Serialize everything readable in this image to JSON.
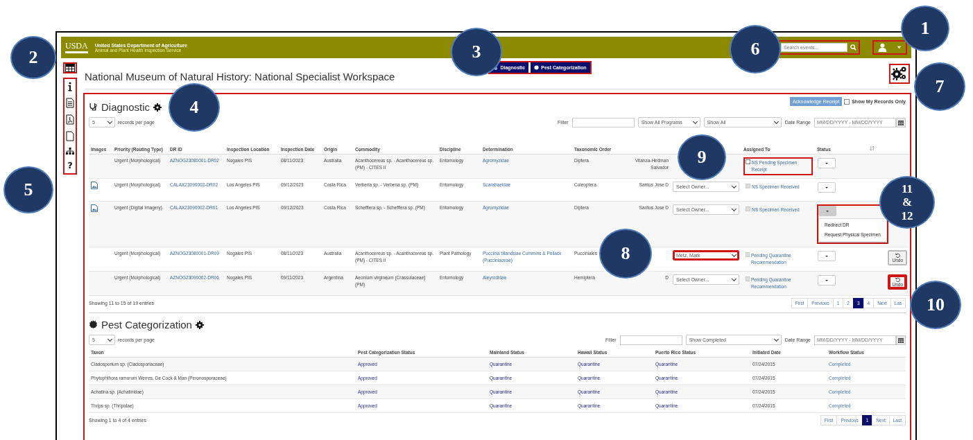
{
  "header": {
    "logo": "USDA",
    "agency": "United States Department of Agriculture",
    "subagency": "Animal and Plant Health Inspection Service",
    "search": {
      "placeholder": "Search events...",
      "highlighted": true
    },
    "user_menu_highlighted": true
  },
  "sidebar": {
    "top_highlighted": true,
    "tools_highlighted": true,
    "help_glyph": "?"
  },
  "page_title": "National Museum of Natural History: National Specialist Workspace",
  "tabs": {
    "highlighted": true,
    "items": [
      {
        "label": "Diagnostic",
        "kind": "diagnostic"
      },
      {
        "label": "Pest Categorization",
        "kind": "pest"
      }
    ]
  },
  "settings_highlighted": true,
  "diagnostic": {
    "title": "Diagnostic",
    "highlighted": true,
    "acknowledge_button": "Acknowledge Receipt",
    "show_my_records": {
      "label": "Show My Records Only",
      "checked": false
    },
    "page_size": "5",
    "page_size_label": "records per page",
    "filter_label": "Filter",
    "program_select": "Show All Programs",
    "status_select": "Show All",
    "date_label": "Date Range",
    "date_placeholder": "MM/DD/YYYY - MM/DD/YYYY",
    "columns": [
      "Images",
      "Priority (Routing Type)",
      "DR ID",
      "Inspection Location",
      "Inspection Date",
      "Origin",
      "Commodity",
      "Discipline",
      "Determination",
      "Taxonomic Order"
    ],
    "columns_right": [
      "Assigned To",
      "Status"
    ],
    "rows": [
      {
        "image": false,
        "priority": "Urgent (Morphological)",
        "dr_id": "AZNOG23080001-DR02",
        "location": "Nogales PIS",
        "date": "08/11/2023",
        "origin": "Australia",
        "commodity": "Acanthocereus sp. - Acanthocereus sp. (PM) - CITES II",
        "discipline": "Entomology",
        "determination": "Agromyzidae",
        "order": "Diptera",
        "identifier": "Vitanza-Hedman Salvador",
        "assigned": {
          "text": "NS Pending Specimen Receipt",
          "disabled": false,
          "highlighted": true
        },
        "status": {
          "label": "...",
          "open": false,
          "highlighted": false
        }
      },
      {
        "image": true,
        "priority": "Urgent (Morphological)",
        "dr_id": "CALAX23090002-DR02",
        "location": "Los Angeles PIS",
        "date": "09/12/2023",
        "origin": "Costa Rica",
        "commodity": "Verbena sp. - Verbena sp. (PM)",
        "discipline": "Entomology",
        "determination": "Scarabaeidae",
        "order": "Coleoptera",
        "identifier": "Santos Jose D",
        "owner": {
          "value": "Select Owner...",
          "highlighted": false
        },
        "assigned": {
          "text": "NS Specimen Received",
          "disabled": true,
          "highlighted": false
        },
        "status": {
          "label": "...",
          "open": false,
          "highlighted": false
        }
      },
      {
        "image": true,
        "priority": "Urgent (Digital Imagery)",
        "dr_id": "CALAX23090002-DR01",
        "location": "Los Angeles PIS",
        "date": "09/12/2023",
        "origin": "Costa Rica",
        "commodity": "Schefflera sp. - Schefflera sp. (PM)",
        "discipline": "Entomology",
        "determination": "Agromyzidae",
        "order": "Diptera",
        "identifier": "Santos Jose D",
        "owner": {
          "value": "Select Owner...",
          "highlighted": false
        },
        "assigned": {
          "text": "NS Specimen Received",
          "disabled": true,
          "highlighted": false
        },
        "status": {
          "label": "...",
          "open": true,
          "highlighted": true,
          "menu": [
            "Redirect DR",
            "Request Physical Specimen"
          ]
        }
      },
      {
        "image": false,
        "priority": "Urgent (Morphological)",
        "dr_id": "AZNOG23080001-DR09",
        "location": "Nogales PIS",
        "date": "08/11/2023",
        "origin": "Australia",
        "commodity": "Acanthocereus sp. - Acanthocereus sp. (PM) - CITES II",
        "discipline": "Plant Pathology",
        "determination": "Puccinia tillandsiae Cummins & Pollack (Pucciniaceae)",
        "order": "Pucciniales",
        "owner": {
          "value": "Metz, Mark",
          "highlighted": true
        },
        "assigned": {
          "text": "Pending Quarantine Recommendation",
          "disabled": true,
          "highlighted": false
        },
        "status": {
          "label": "...",
          "open": false,
          "highlighted": false
        },
        "undo": {
          "label": "Undo",
          "highlighted": false
        }
      },
      {
        "image": false,
        "priority": "Urgent (Morphological)",
        "dr_id": "AZNOG23090002-DR06",
        "location": "Nogales PIS",
        "date": "09/11/2023",
        "origin": "Argentina",
        "commodity": "Aeonium virgineum (Crassulaceae) (PM)",
        "discipline": "Entomology",
        "determination": "Aleyrodidae",
        "order": "Hemiptera",
        "identifier": "D",
        "owner": {
          "value": "Select Owner...",
          "highlighted": false
        },
        "assigned": {
          "text": "Pending Quarantine Recommendation",
          "disabled": true,
          "highlighted": false
        },
        "status": {
          "label": "...",
          "open": false,
          "highlighted": false
        },
        "undo": {
          "label": "Undo",
          "highlighted": true
        }
      }
    ],
    "summary": "Showing 11 to 15 of 19 entries",
    "pagination": [
      {
        "label": "First",
        "selected": false
      },
      {
        "label": "Previous",
        "selected": false
      },
      {
        "label": "1",
        "selected": false
      },
      {
        "label": "2",
        "selected": false
      },
      {
        "label": "3",
        "selected": true
      },
      {
        "label": "4",
        "selected": false
      },
      {
        "label": "Next",
        "selected": false
      },
      {
        "label": "Las",
        "selected": false
      }
    ]
  },
  "pest": {
    "title": "Pest Categorization",
    "page_size": "5",
    "page_size_label": "records per page",
    "filter_label": "Filter",
    "status_select": "Show Completed",
    "date_label": "Date Range",
    "date_placeholder": "MM/DD/YYYY - MM/DD/YYYY",
    "columns": [
      "Taxon",
      "Pest Categorization Status",
      "Mainland Status",
      "Hawaii Status",
      "Puerto Rico Status",
      "Initiated Date",
      "Workflow Status"
    ],
    "rows": [
      [
        "Cladosporium sp. (Cladosporiaceae)",
        "Approved",
        "Quarantine",
        "Quarantine",
        "Quarantine",
        "07/24/2015",
        "Completed"
      ],
      [
        "Phytophthora ramorum Werres, De Cock & Man (Peronosporaceae)",
        "Approved",
        "Quarantine",
        "Quarantine",
        "Quarantine",
        "07/24/2015",
        "Completed"
      ],
      [
        "Achatina sp. (Achatinidae)",
        "Approved",
        "Quarantine",
        "Quarantine",
        "Quarantine",
        "07/24/2015",
        "Completed"
      ],
      [
        "Thrips sp. (Thripidae)",
        "Approved",
        "Quarantine",
        "Quarantine",
        "Quarantine",
        "07/24/2015",
        "Completed"
      ]
    ],
    "summary": "Showing 1 to 4 of 4 entries",
    "pagination": [
      {
        "label": "First",
        "selected": false
      },
      {
        "label": "Previous",
        "selected": false
      },
      {
        "label": "1",
        "selected": true
      },
      {
        "label": "Next",
        "selected": false
      },
      {
        "label": "Last",
        "selected": false
      }
    ]
  },
  "callouts": [
    {
      "lines": [
        "1"
      ]
    },
    {
      "lines": [
        "2"
      ]
    },
    {
      "lines": [
        "3"
      ]
    },
    {
      "lines": [
        "4"
      ]
    },
    {
      "lines": [
        "5"
      ]
    },
    {
      "lines": [
        "6"
      ]
    },
    {
      "lines": [
        "7"
      ]
    },
    {
      "lines": [
        "8"
      ]
    },
    {
      "lines": [
        "9"
      ]
    },
    {
      "lines": [
        "10"
      ]
    },
    {
      "lines": [
        "11",
        "&",
        "12"
      ]
    }
  ]
}
